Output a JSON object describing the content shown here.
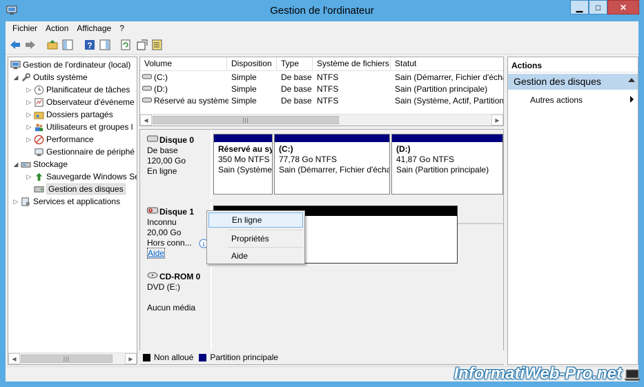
{
  "window": {
    "title": "Gestion de l'ordinateur"
  },
  "menu": [
    "Fichier",
    "Action",
    "Affichage",
    "?"
  ],
  "tree": {
    "root": "Gestion de l'ordinateur (local)",
    "items": [
      {
        "label": "Outils système"
      },
      {
        "label": "Planificateur de tâches"
      },
      {
        "label": "Observateur d'événeme"
      },
      {
        "label": "Dossiers partagés"
      },
      {
        "label": "Utilisateurs et groupes l"
      },
      {
        "label": "Performance"
      },
      {
        "label": "Gestionnaire de périphé"
      },
      {
        "label": "Stockage"
      },
      {
        "label": "Sauvegarde Windows Se"
      },
      {
        "label": "Gestion des disques"
      },
      {
        "label": "Services et applications"
      }
    ]
  },
  "volumes": {
    "columns": [
      "Volume",
      "Disposition",
      "Type",
      "Système de fichiers",
      "Statut"
    ],
    "rows": [
      [
        "(C:)",
        "Simple",
        "De base",
        "NTFS",
        "Sain (Démarrer, Fichier d'écha"
      ],
      [
        "(D:)",
        "Simple",
        "De base",
        "NTFS",
        "Sain (Partition principale)"
      ],
      [
        "Réservé au système",
        "Simple",
        "De base",
        "NTFS",
        "Sain (Système, Actif, Partition"
      ]
    ]
  },
  "disks": {
    "disk0": {
      "name": "Disque 0",
      "type": "De base",
      "size": "120,00 Go",
      "status": "En ligne",
      "partitions": [
        {
          "name": "Réservé au sy",
          "size": "350 Mo NTFS",
          "status": "Sain (Système"
        },
        {
          "name": "(C:)",
          "size": "77,78 Go NTFS",
          "status": "Sain (Démarrer, Fichier d'écha"
        },
        {
          "name": "(D:)",
          "size": "41,87 Go NTFS",
          "status": "Sain (Partition principale)"
        }
      ]
    },
    "disk1": {
      "name": "Disque 1",
      "type": "Inconnu",
      "size": "20,00 Go",
      "status": "Hors conn...",
      "help": "Aide"
    },
    "cdrom0": {
      "name": "CD-ROM 0",
      "type": "DVD (E:)",
      "status": "Aucun média"
    }
  },
  "context_menu": {
    "items": [
      "En ligne",
      "Propriétés",
      "Aide"
    ]
  },
  "legend": {
    "unallocated": "Non alloué",
    "primary": "Partition principale",
    "unallocated_color": "#000000",
    "primary_color": "#00007f"
  },
  "actions": {
    "header": "Actions",
    "section": "Gestion des disques",
    "item": "Autres actions"
  },
  "watermark": "InformatiWeb-Pro.net"
}
